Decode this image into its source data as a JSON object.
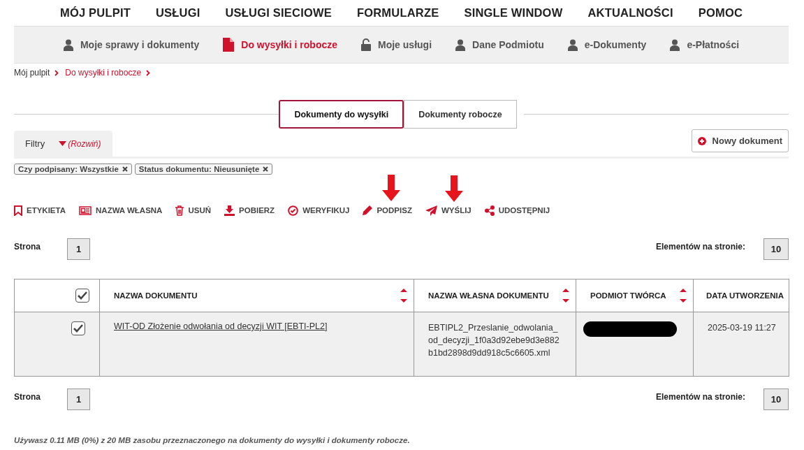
{
  "top_nav": [
    {
      "label": "MÓJ PULPIT"
    },
    {
      "label": "USŁUGI"
    },
    {
      "label": "USŁUGI SIECIOWE"
    },
    {
      "label": "FORMULARZE"
    },
    {
      "label": "SINGLE WINDOW"
    },
    {
      "label": "AKTUALNOŚCI"
    },
    {
      "label": "POMOC"
    }
  ],
  "sub_nav": [
    {
      "label": "Moje sprawy i dokumenty",
      "selected": false
    },
    {
      "label": "Do wysyłki i robocze",
      "selected": true
    },
    {
      "label": "Moje usługi",
      "selected": false
    },
    {
      "label": "Dane Podmiotu",
      "selected": false
    },
    {
      "label": "e-Dokumenty",
      "selected": false
    },
    {
      "label": "e-Płatności",
      "selected": false
    }
  ],
  "breadcrumb": [
    {
      "label": "Mój pulpit",
      "current": false
    },
    {
      "label": "Do wysyłki i robocze",
      "current": true
    }
  ],
  "tabs": [
    {
      "label": "Dokumenty do wysyłki",
      "selected": true
    },
    {
      "label": "Dokumenty robocze",
      "selected": false
    }
  ],
  "filters": {
    "label": "Filtry",
    "toggle": "(Rozwiń)",
    "expanded": false
  },
  "new_button": "Nowy dokument",
  "active_filters": [
    {
      "label": "Czy podpisany: Wszystkie"
    },
    {
      "label": "Status dokumentu: Nieusunięte"
    }
  ],
  "toolbar": [
    {
      "label": "ETYKIETA",
      "annotated": false
    },
    {
      "label": "NAZWA WŁASNA",
      "annotated": false
    },
    {
      "label": "USUŃ",
      "annotated": false
    },
    {
      "label": "POBIERZ",
      "annotated": false
    },
    {
      "label": "WERYFIKUJ",
      "annotated": false
    },
    {
      "label": "PODPISZ",
      "annotated": true
    },
    {
      "label": "WYŚLIJ",
      "annotated": true
    },
    {
      "label": "UDOSTĘPNIJ",
      "annotated": false
    }
  ],
  "pager_top": {
    "page_label": "Strona",
    "page": "1",
    "per_page_label": "Elementów na stronie:",
    "per_page": "10"
  },
  "table": {
    "columns": [
      {
        "kind": "checkbox",
        "checked": true
      },
      {
        "kind": "text",
        "label": "NAZWA DOKUMENTU",
        "sortable": true
      },
      {
        "kind": "text",
        "label": "NAZWA WŁASNA DOKUMENTU",
        "sortable": true
      },
      {
        "kind": "text",
        "label": "PODMIOT TWÓRCA",
        "sortable": true
      },
      {
        "kind": "text",
        "label": "DATA UTWORZENIA",
        "sortable": false
      }
    ],
    "rows": [
      {
        "cells": [
          {
            "kind": "checkbox",
            "checked": true
          },
          {
            "kind": "link",
            "text": "WIT-OD Złożenie odwołania od decyzji WIT [EBTI-PL2]"
          },
          {
            "kind": "text",
            "text": "EBTIPL2_Przeslanie_odwolania_od_decyzji_1f0a3d92ebe9d3e882b1bd2898d9dd918c5c6605.xml"
          },
          {
            "kind": "redacted"
          },
          {
            "kind": "text",
            "text": "2025-03-19 11:27"
          }
        ]
      }
    ]
  },
  "pager_bottom": {
    "page_label": "Strona",
    "page": "1",
    "per_page_label": "Elementów na stronie:",
    "per_page": "10"
  },
  "usage_note": "Używasz 0.11 MB (0%) z 20 MB zasobu przeznaczonego na dokumenty do wysyłki i dokumenty robocze."
}
